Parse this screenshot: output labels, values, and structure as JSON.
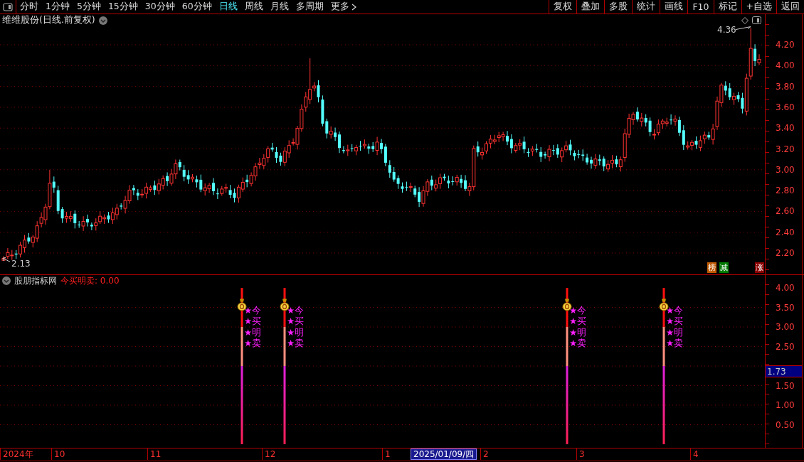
{
  "toolbar": {
    "periods": [
      {
        "label": "分时",
        "selected": false
      },
      {
        "label": "1分钟",
        "selected": false
      },
      {
        "label": "5分钟",
        "selected": false
      },
      {
        "label": "15分钟",
        "selected": false
      },
      {
        "label": "30分钟",
        "selected": false
      },
      {
        "label": "60分钟",
        "selected": false
      },
      {
        "label": "日线",
        "selected": true
      },
      {
        "label": "周线",
        "selected": false
      },
      {
        "label": "月线",
        "selected": false
      },
      {
        "label": "多周期",
        "selected": false
      },
      {
        "label": "更多",
        "selected": false
      }
    ],
    "buttons": [
      "复权",
      "叠加",
      "多股",
      "统计",
      "画线",
      "F10",
      "标记",
      "+自选",
      "返回"
    ]
  },
  "chart": {
    "title": "维维股份(日线.前复权)",
    "price_labels": [
      "4.20",
      "4.00",
      "3.80",
      "3.60",
      "3.40",
      "3.20",
      "3.00",
      "2.80",
      "2.60",
      "2.40",
      "2.20"
    ],
    "high_label": "4.36",
    "low_label": "2.13",
    "tags": [
      {
        "text": "榜",
        "color": "#c05a00"
      },
      {
        "text": "减",
        "color": "#007a00"
      },
      {
        "text": "涨",
        "color": "#8a0000"
      }
    ]
  },
  "indicator": {
    "name": "股朋指标网",
    "reading": "今买明卖: 0.00",
    "axis_labels": [
      "4.00",
      "3.50",
      "3.00",
      "2.50",
      "1.50",
      "1.00",
      "0.50"
    ],
    "cursor_value": "1.73",
    "signals": [
      {
        "labels": [
          "★今",
          "★买",
          "★明",
          "★卖"
        ]
      },
      {
        "labels": [
          "★今",
          "★买",
          "★明",
          "★卖"
        ]
      },
      {
        "labels": [
          "★今",
          "★买",
          "★明",
          "★卖"
        ]
      },
      {
        "labels": [
          "★今",
          "★买",
          "★明",
          "★卖"
        ]
      }
    ]
  },
  "date_axis": {
    "labels": [
      {
        "text": "2024年",
        "selected": false
      },
      {
        "text": "10",
        "selected": false
      },
      {
        "text": "11",
        "selected": false
      },
      {
        "text": "12",
        "selected": false
      },
      {
        "text": "1",
        "selected": false
      },
      {
        "text": "2025/01/09/四",
        "selected": true
      },
      {
        "text": "2",
        "selected": false
      },
      {
        "text": "3",
        "selected": false
      },
      {
        "text": "4",
        "selected": false
      }
    ]
  }
}
